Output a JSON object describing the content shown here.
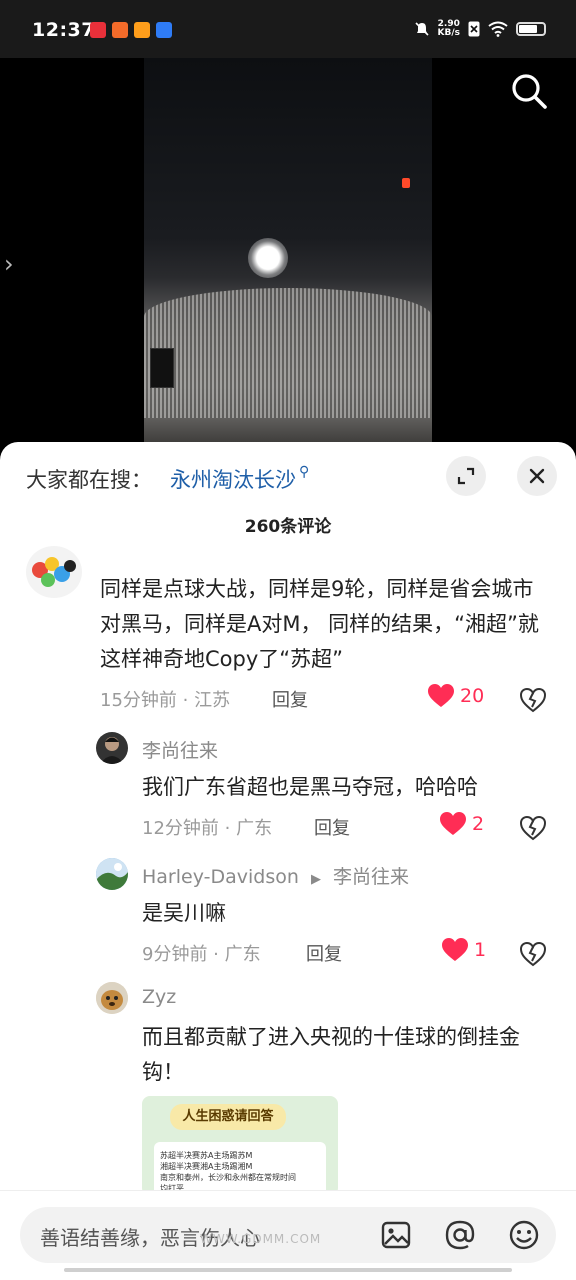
{
  "status_bar": {
    "time": "12:37",
    "net_speed_value": "2.90",
    "net_speed_unit": "KB/s"
  },
  "sheet": {
    "hot_search_label": "大家都在搜：",
    "hot_search_keyword": "永州淘汰长沙",
    "comment_count_title": "260条评论"
  },
  "comments": [
    {
      "username": "",
      "text": "同样是点球大战，同样是9轮，同样是省会城市对黑马，同样是A对M， 同样的结果，“湘超”就这样神奇地Copy了“苏超”",
      "time_location": "15分钟前 · 江苏",
      "reply_label": "回复",
      "likes": "20"
    },
    {
      "username": "李尚往来",
      "text": "我们广东省超也是黑马夺冠，哈哈哈",
      "time_location": "12分钟前 · 广东",
      "reply_label": "回复",
      "likes": "2"
    },
    {
      "username": "Harley-Davidson",
      "reply_to": "李尚往来",
      "text": "是吴川嘛",
      "time_location": "9分钟前 · 广东",
      "reply_label": "回复",
      "likes": "1"
    },
    {
      "username": "Zyz",
      "text": "而且都贡献了进入央视的十佳球的倒挂金钩！",
      "image_title": "人生困惑请回答",
      "image_lines": [
        "苏超半决赛苏A主场踢苏M",
        "湘超半决赛湘A主场踢湘M",
        "南京和泰州，长沙和永州都在常规时间",
        "均打平"
      ]
    }
  ],
  "input": {
    "placeholder": "善语结善缘，恶言伤人心"
  },
  "watermark": "WWW.GDMM.COM",
  "colors": {
    "like": "#ff2d55",
    "link": "#1f5fa8"
  }
}
